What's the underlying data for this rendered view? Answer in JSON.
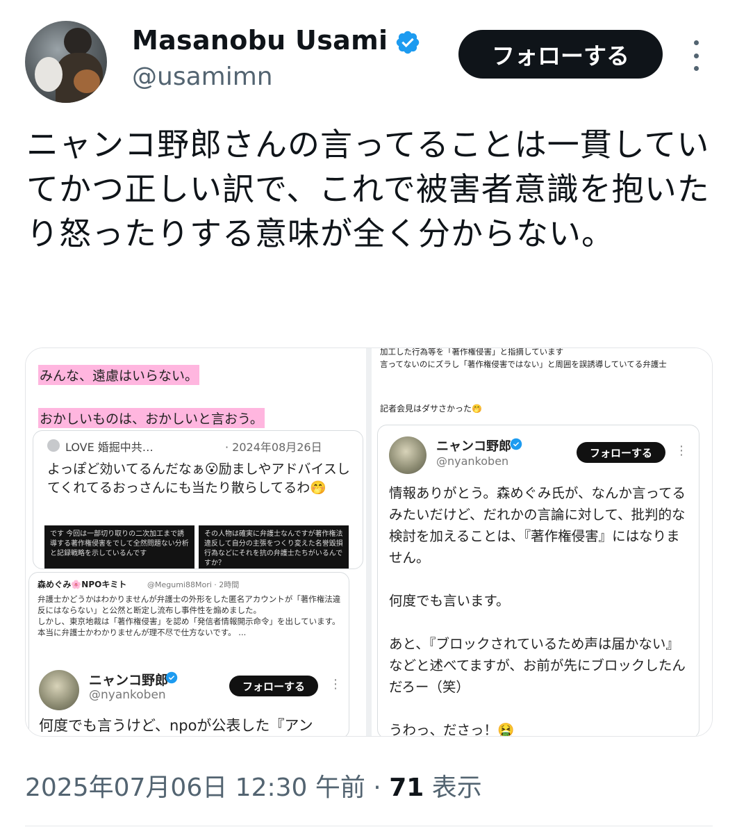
{
  "author": {
    "name": "Masanobu Usami",
    "handle": "@usamimn",
    "follow_label": "フォローする"
  },
  "tweet": {
    "text": "ニャンコ野郎さんの言ってることは一貫していてかつ正しい訳で、これで被害者意識を抱いたり怒ったりする意味が全く分からない。"
  },
  "media": {
    "left": {
      "highlight1": "みんな、遠慮はいらない。",
      "highlight2": "おかしいものは、おかしいと言おう。",
      "quote1": {
        "account": "LOVE 婚掘中共…",
        "date": "· 2024年08月26日",
        "text": "よっぽど効いてるんだなぁ😮励ましやアドバイスしてくれてるおっさんにも当たり散らしてるわ🤭",
        "image1": "です 今回は一部切り取りの二次加工まで誘導する著作権侵害をでして全然問題ない分析と記録戦略を示しているんです",
        "image2": "その人物は確実に弁護士なんですが著作権法違反して自分の主張をつくり変えた名誉毀損行為などにそれを抗の弁護士たちがいるんですか？"
      },
      "quote2": {
        "account": "森めぐみ🌸NPOキミト",
        "handle": "@Megumi88Mori · 2時間",
        "body": "弁護士かどうかはわかりませんが弁護士の外形をした匿名アカウントが「著作権法違反にはならない」と公然と断定し流布し事件性を煽めました。\nしかし、東京地裁は「著作権侵害」を認め「発信者情報開示命令」を出しています。\n本当に弁護士かわかりませんが理不尽で仕方ないです。 ...",
        "name": "ニャンコ野郎",
        "at": "@nyankoben",
        "follow": "フォローする",
        "text": "何度でも言うけど、npoが公表した『アン"
      }
    },
    "right": {
      "top_lines": "加工した行為等を「著作権侵害」と指摘しています\n言ってないのにズラし「著作権侵害ではない」と周囲を誤誘導していてる弁護士",
      "note": "記者会見はダサさかった🤭",
      "card": {
        "name": "ニャンコ野郎",
        "at": "@nyankoben",
        "follow": "フォローする",
        "body": "情報ありがとう。森めぐみ氏が、なんか言ってるみたいだけど、だれかの言論に対して、批判的な検討を加えることは、『著作権侵害』にはなりません。\n\n何度でも言います。\n\nあと、『ブロックされているため声は届かない』などと述べてますが、お前が先にブロックしたんだろー（笑）\n\nうわっ、ださっ！🤮"
      }
    }
  },
  "meta": {
    "timestamp": "2025年07月06日 12:30 午前 · ",
    "views_count": "71",
    "views_label": " 表示"
  },
  "colors": {
    "verified": "#1d9bf0",
    "follow_bg": "#0f1419",
    "secondary_text": "#536471",
    "highlight": "#ffb6df"
  }
}
